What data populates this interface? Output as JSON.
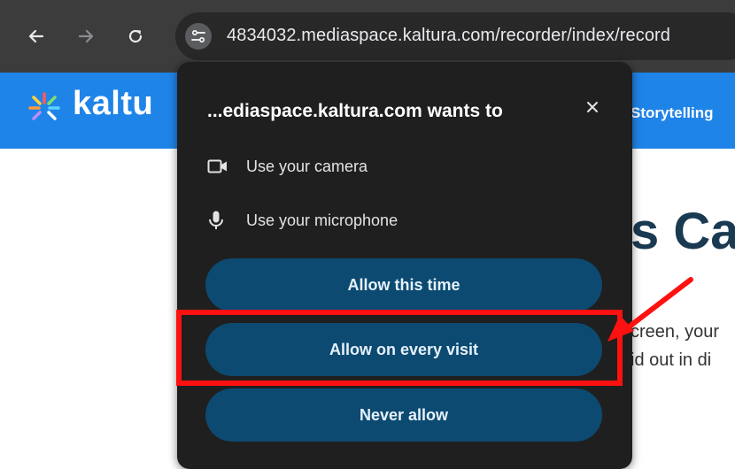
{
  "browser": {
    "back_icon": "arrow-left-icon",
    "forward_icon": "arrow-right-icon",
    "reload_icon": "reload-icon",
    "site_info_icon": "tune-icon",
    "url": "4834032.mediaspace.kaltura.com/recorder/index/record"
  },
  "site": {
    "logo_text": "kaltu",
    "nav_item": "Storytelling",
    "brand_color": "#1f84e8"
  },
  "page": {
    "title_partial": "s Ca",
    "text_line1": "creen, your",
    "text_line2": "id out in di"
  },
  "permission_popup": {
    "title": "...ediaspace.kaltura.com wants to",
    "close_icon": "close-icon",
    "permissions": [
      {
        "icon": "camera-icon",
        "label": "Use your camera"
      },
      {
        "icon": "microphone-icon",
        "label": "Use your microphone"
      }
    ],
    "buttons": {
      "allow_once": "Allow this time",
      "allow_always": "Allow on every visit",
      "never": "Never allow"
    },
    "button_color": "#0c4a72"
  },
  "annotation": {
    "highlight_color": "#ff1111",
    "highlighted_option": "Allow on every visit"
  }
}
